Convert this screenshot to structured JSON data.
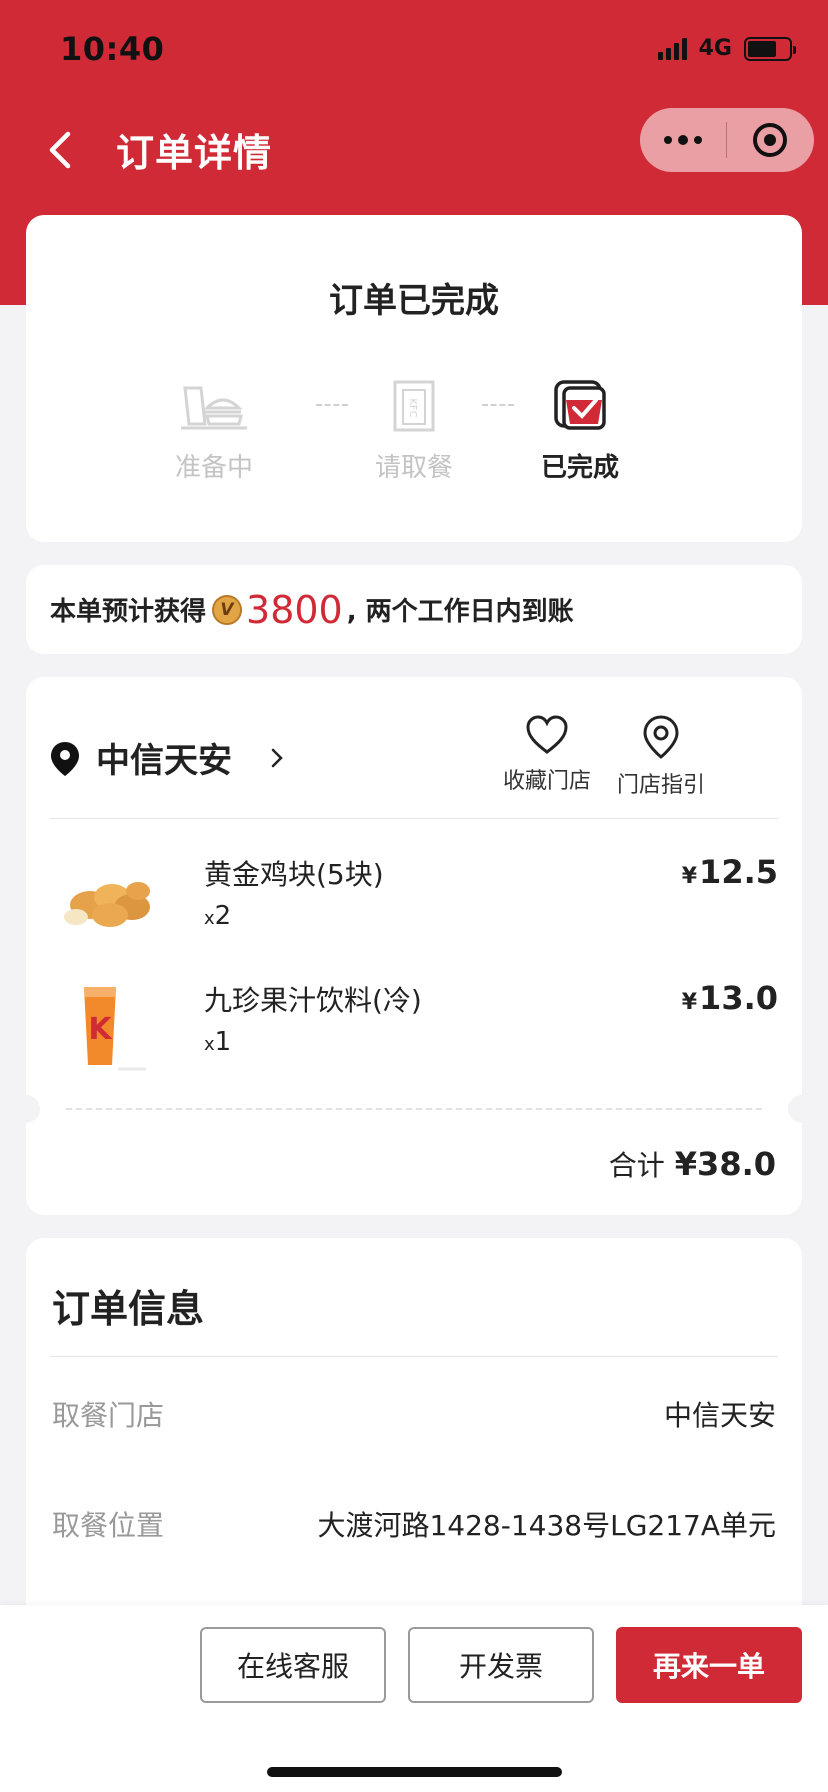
{
  "status_bar": {
    "time": "10:40",
    "network": "4G",
    "battery_level_percent": 70
  },
  "nav": {
    "back_icon": "chevron-left-icon",
    "title": "订单详情",
    "more_icon": "more-dots-icon",
    "close_icon": "target-close-icon"
  },
  "order_status": {
    "title": "订单已完成",
    "steps": [
      {
        "label": "准备中",
        "icon": "meal-tray-icon",
        "active": false
      },
      {
        "label": "请取餐",
        "icon": "kfc-bag-icon",
        "active": false
      },
      {
        "label": "已完成",
        "icon": "completed-check-icon",
        "active": true
      }
    ]
  },
  "points": {
    "prefix": "本单预计获得",
    "coin_icon": "v-coin-icon",
    "amount": "3800",
    "suffix": ", 两个工作日内到账"
  },
  "store": {
    "name": "中信天安",
    "pin_icon": "location-pin-icon",
    "chevron_icon": "chevron-right-icon",
    "actions": [
      {
        "label": "收藏门店",
        "icon": "heart-icon"
      },
      {
        "label": "门店指引",
        "icon": "map-pin-icon"
      }
    ]
  },
  "items": [
    {
      "name": "黄金鸡块(5块)",
      "qty_prefix": "x",
      "qty": "2",
      "currency": "¥",
      "price": "12.5",
      "image": "chicken-nuggets-image"
    },
    {
      "name": "九珍果汁饮料(冷)",
      "qty_prefix": "x",
      "qty": "1",
      "currency": "¥",
      "price": "13.0",
      "image": "juice-cup-image"
    }
  ],
  "total": {
    "label": "合计",
    "value": "¥38.0"
  },
  "order_info": {
    "title": "订单信息",
    "rows": [
      {
        "key": "取餐门店",
        "value": "中信天安"
      },
      {
        "key": "取餐位置",
        "value": "大渡河路1428-1438号LG217A单元"
      }
    ]
  },
  "bottom_bar": {
    "customer_service": "在线客服",
    "invoice": "开发票",
    "reorder": "再来一单"
  },
  "colors": {
    "brand_red": "#d12a37",
    "background": "#f3f3f5"
  }
}
